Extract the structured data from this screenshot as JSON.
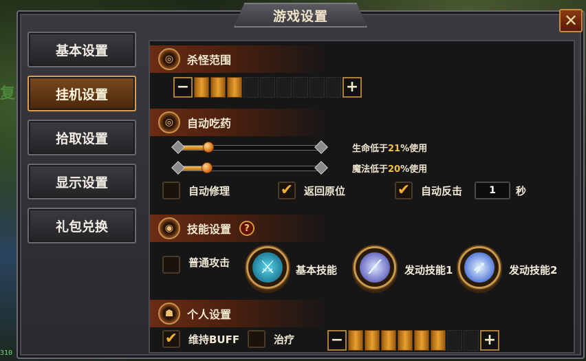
{
  "background": {
    "partial_text": "复",
    "counter": "310"
  },
  "window": {
    "title": "游戏设置",
    "close_glyph": "✕"
  },
  "sidebar": {
    "items": [
      {
        "label": "基本设置",
        "active": false
      },
      {
        "label": "挂机设置",
        "active": true
      },
      {
        "label": "拾取设置",
        "active": false
      },
      {
        "label": "显示设置",
        "active": false
      },
      {
        "label": "礼包兑换",
        "active": false
      }
    ]
  },
  "range": {
    "title": "杀怪范围",
    "minus": "−",
    "plus": "+",
    "level": 3,
    "max": 9
  },
  "potion": {
    "title": "自动吃药",
    "hp": {
      "prefix": "生命低于",
      "value": "21",
      "suffix": "%使用",
      "fraction": 0.21
    },
    "mp": {
      "prefix": "魔法低于",
      "value": "20",
      "suffix": "%使用",
      "fraction": 0.2
    },
    "auto_repair": {
      "label": "自动修理",
      "checked": false
    },
    "return_origin": {
      "label": "返回原位",
      "checked": true
    },
    "auto_counter": {
      "label": "自动反击",
      "checked": true
    },
    "counter_seconds": "1",
    "seconds_unit": "秒"
  },
  "skills": {
    "title": "技能设置",
    "help_glyph": "?",
    "normal_attack": {
      "label": "普通攻击",
      "checked": false
    },
    "basic_skill": {
      "label": "基本技能",
      "icon": "blue-blade-skill-icon"
    },
    "trigger_skill_1": {
      "label": "发动技能1",
      "icon": "purple-slash-skill-icon"
    },
    "trigger_skill_2": {
      "label": "发动技能2",
      "icon": "blue-sword-skill-icon"
    }
  },
  "personal": {
    "title": "个人设置",
    "keep_buff": {
      "label": "维持BUFF",
      "checked": true
    },
    "heal": {
      "label": "治疗",
      "checked": false
    },
    "minus": "−",
    "plus": "+",
    "level": 6,
    "max": 8
  },
  "colors": {
    "accent": "#e8a030",
    "check": "#f4b030",
    "highlight": "#f4c040"
  }
}
